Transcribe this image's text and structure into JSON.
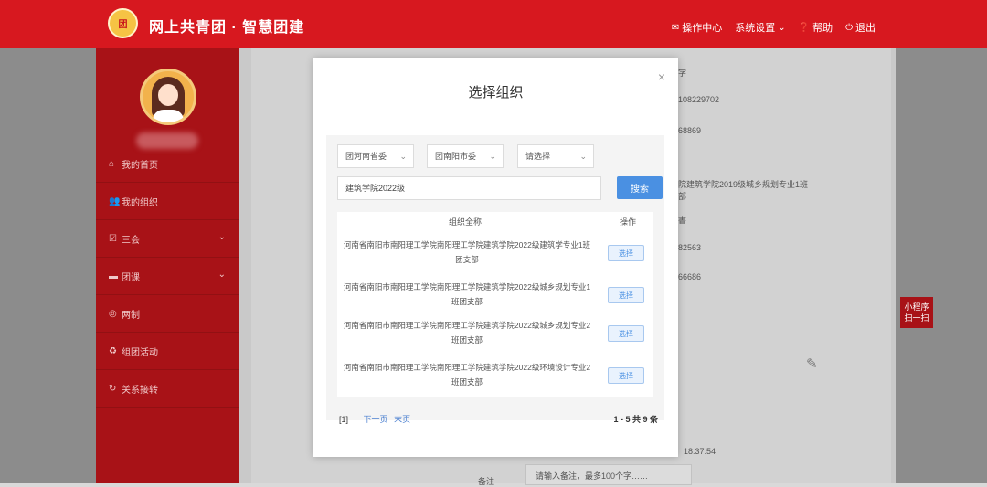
{
  "header": {
    "logo_text": "团",
    "brand": "网上共青团 · 智慧团建",
    "nav": [
      {
        "icon": "mail-icon",
        "label": "操作中心"
      },
      {
        "icon": "chevron-down-icon",
        "label": "系统设置"
      },
      {
        "icon": "help-icon",
        "label": "帮助"
      },
      {
        "icon": "power-icon",
        "label": "退出"
      }
    ]
  },
  "sidebar": {
    "items": [
      {
        "icon": "home-icon",
        "label": "我的首页"
      },
      {
        "icon": "users-icon",
        "label": "我的组织"
      },
      {
        "icon": "checkbox-icon",
        "label": "三会"
      },
      {
        "icon": "folder-icon",
        "label": "团课"
      },
      {
        "icon": "target-icon",
        "label": "两制"
      },
      {
        "icon": "recycle-icon",
        "label": "组团活动"
      },
      {
        "icon": "refresh-icon",
        "label": "关系接转"
      }
    ]
  },
  "background_fields": [
    "字",
    "108229702",
    "68869",
    "院建筑学院2019级城乡规划专业1班",
    "部",
    "書",
    "82563",
    "66686",
    "18:37:54",
    "请输入备注，最多100个字……",
    "备注"
  ],
  "mini_program": {
    "line1": "小程序",
    "line2": "扫一扫"
  },
  "modal": {
    "close_label": "×",
    "title": "选择组织",
    "selects": [
      "团河南省委",
      "团南阳市委",
      "请选择"
    ],
    "search_value": "建筑学院2022级",
    "search_button": "搜索",
    "columns": [
      "组织全称",
      "操作"
    ],
    "rows": [
      {
        "name": "河南省南阳市南阳理工学院南阳理工学院建筑学院2022级建筑学专业1班团支部",
        "action": "选择"
      },
      {
        "name": "河南省南阳市南阳理工学院南阳理工学院建筑学院2022级城乡规划专业1班团支部",
        "action": "选择"
      },
      {
        "name": "河南省南阳市南阳理工学院南阳理工学院建筑学院2022级城乡规划专业2班团支部",
        "action": "选择"
      },
      {
        "name": "河南省南阳市南阳理工学院南阳理工学院建筑学院2022级环境设计专业2班团支部",
        "action": "选择"
      }
    ],
    "pager": {
      "current": "[1]",
      "next": "下一页",
      "last": "末页"
    },
    "summary": "1 - 5  共 9 条"
  }
}
